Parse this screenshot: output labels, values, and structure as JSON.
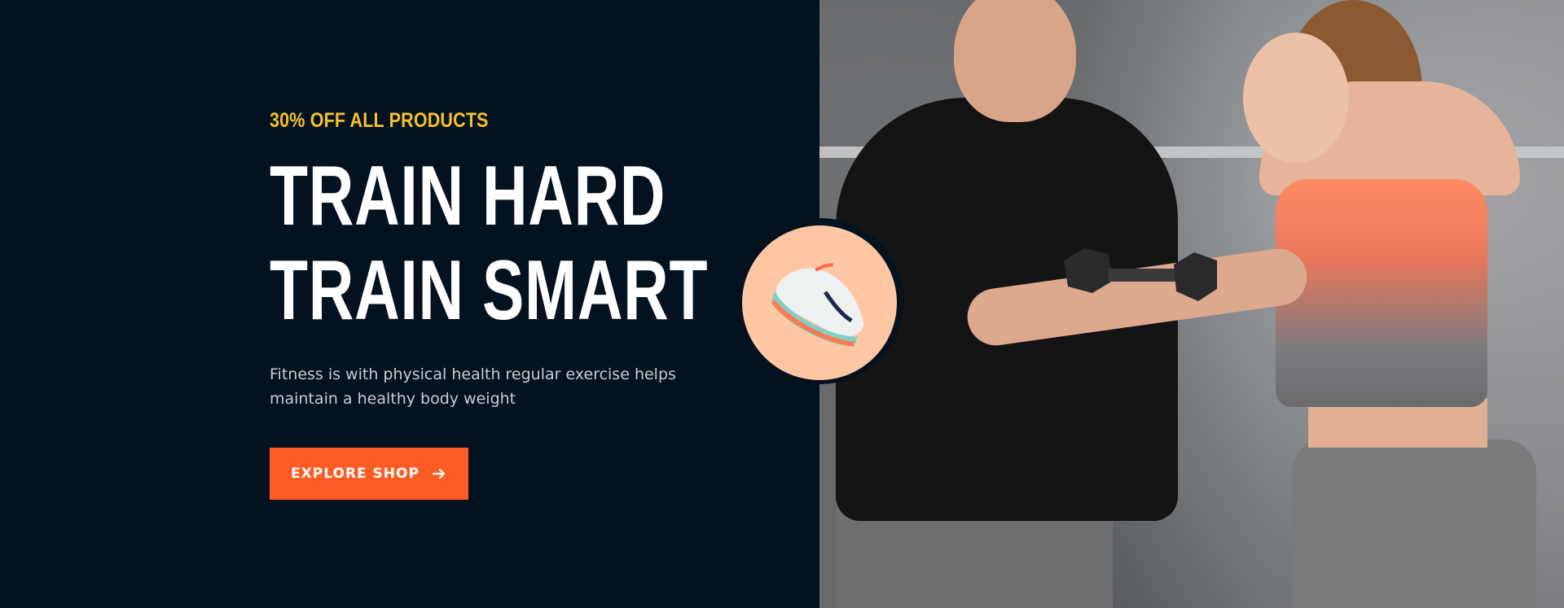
{
  "promo": {
    "eyebrow": "30% OFF ALL PRODUCTS",
    "headline_line1": "TRAIN HARD",
    "headline_line2": "TRAIN SMART",
    "description": "Fitness is with physical health regular exercise helps maintain a healthy body weight",
    "cta_label": "EXPLORE SHOP",
    "cta_icon": "arrow-right-icon"
  },
  "colors": {
    "background": "#02121f",
    "accent_yellow": "#f6c12b",
    "accent_orange": "#ff5b24",
    "product_circle": "#ffc6a4",
    "text_white": "#ffffff",
    "text_muted": "#c9cdd3"
  },
  "media": {
    "hero_photo": "trainer-and-woman-lifting-dumbbell-photo",
    "product_image": "running-shoe-image"
  }
}
